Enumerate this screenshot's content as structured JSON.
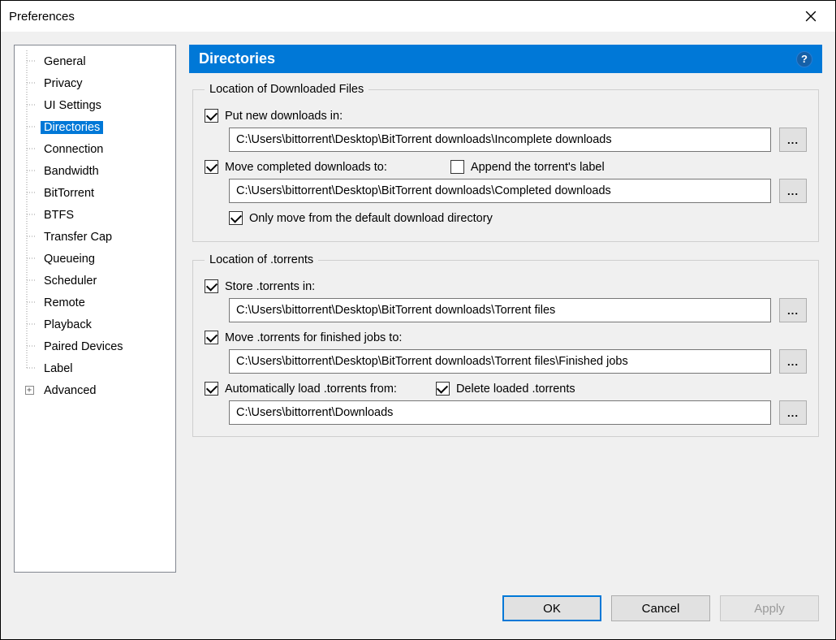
{
  "window": {
    "title": "Preferences"
  },
  "sidebar": {
    "items": [
      {
        "label": "General",
        "selected": false,
        "expandable": false
      },
      {
        "label": "Privacy",
        "selected": false,
        "expandable": false
      },
      {
        "label": "UI Settings",
        "selected": false,
        "expandable": false
      },
      {
        "label": "Directories",
        "selected": true,
        "expandable": false
      },
      {
        "label": "Connection",
        "selected": false,
        "expandable": false
      },
      {
        "label": "Bandwidth",
        "selected": false,
        "expandable": false
      },
      {
        "label": "BitTorrent",
        "selected": false,
        "expandable": false
      },
      {
        "label": "BTFS",
        "selected": false,
        "expandable": false
      },
      {
        "label": "Transfer Cap",
        "selected": false,
        "expandable": false
      },
      {
        "label": "Queueing",
        "selected": false,
        "expandable": false
      },
      {
        "label": "Scheduler",
        "selected": false,
        "expandable": false
      },
      {
        "label": "Remote",
        "selected": false,
        "expandable": false
      },
      {
        "label": "Playback",
        "selected": false,
        "expandable": false
      },
      {
        "label": "Paired Devices",
        "selected": false,
        "expandable": false
      },
      {
        "label": "Label",
        "selected": false,
        "expandable": false
      },
      {
        "label": "Advanced",
        "selected": false,
        "expandable": true
      }
    ]
  },
  "panel": {
    "title": "Directories",
    "group1": {
      "legend": "Location of Downloaded Files",
      "put_new_label": "Put new downloads in:",
      "put_new_checked": true,
      "put_new_path": "C:\\Users\\bittorrent\\Desktop\\BitTorrent downloads\\Incomplete downloads",
      "move_completed_label": "Move completed downloads to:",
      "move_completed_checked": true,
      "append_label_label": "Append the torrent's label",
      "append_label_checked": false,
      "move_completed_path": "C:\\Users\\bittorrent\\Desktop\\BitTorrent downloads\\Completed downloads",
      "only_move_label": "Only move from the default download directory",
      "only_move_checked": true
    },
    "group2": {
      "legend": "Location of .torrents",
      "store_label": "Store .torrents in:",
      "store_checked": true,
      "store_path": "C:\\Users\\bittorrent\\Desktop\\BitTorrent downloads\\Torrent files",
      "move_finished_label": "Move .torrents for finished jobs to:",
      "move_finished_checked": true,
      "move_finished_path": "C:\\Users\\bittorrent\\Desktop\\BitTorrent downloads\\Torrent files\\Finished jobs",
      "autoload_label": "Automatically load .torrents from:",
      "autoload_checked": true,
      "delete_loaded_label": "Delete loaded .torrents",
      "delete_loaded_checked": true,
      "autoload_path": "C:\\Users\\bittorrent\\Downloads"
    }
  },
  "buttons": {
    "browse": "...",
    "ok": "OK",
    "cancel": "Cancel",
    "apply": "Apply"
  }
}
